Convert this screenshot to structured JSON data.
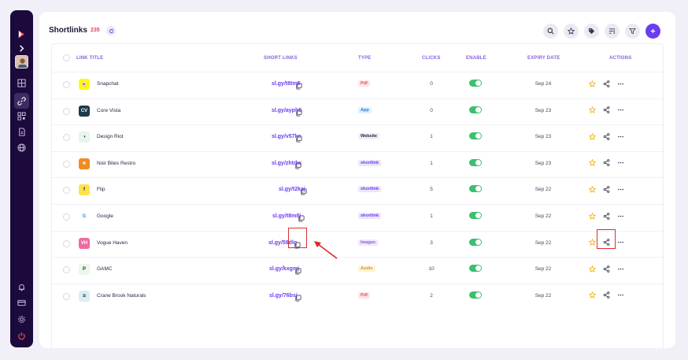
{
  "header": {
    "title": "Shortlinks",
    "count": "235"
  },
  "columns": {
    "link_title": "LINK TITLE",
    "short_links": "SHORT LINKS",
    "type": "TYPE",
    "clicks": "CLICKS",
    "enable": "ENABLE",
    "expiry_date": "EXPIRY DATE",
    "actions": "ACTIONS"
  },
  "rows": [
    {
      "name": "Snapchat",
      "short": "sl.gy/t8tm5",
      "type": "Pdf",
      "clicks": "0",
      "expiry": "Sep 24",
      "logo_color": "#fffc00",
      "logo_glyph": "👻"
    },
    {
      "name": "Core Vista",
      "short": "sl.gy/ayph5",
      "type": "App",
      "clicks": "0",
      "expiry": "Sep 23",
      "logo_color": "#1e3a4c",
      "logo_glyph": "CV"
    },
    {
      "name": "Design Riot",
      "short": "sl.gy/v57ke",
      "type": "Website",
      "clicks": "1",
      "expiry": "Sep 23",
      "logo_color": "#e8f5ec",
      "logo_glyph": "◑"
    },
    {
      "name": "Noir Bites Restro",
      "short": "sl.gy/zhtdw",
      "type": "shortlink",
      "clicks": "1",
      "expiry": "Sep 23",
      "logo_color": "#f08a24",
      "logo_glyph": "❖"
    },
    {
      "name": "Flip",
      "short": "sl.gy/t2kaj",
      "type": "shortlink",
      "clicks": "5",
      "expiry": "Sep 22",
      "logo_color": "#ffe14d",
      "logo_glyph": "f"
    },
    {
      "name": "Google",
      "short": "sl.gy/t8m8j",
      "type": "shortlink",
      "clicks": "1",
      "expiry": "Sep 22",
      "logo_color": "#ffffff",
      "logo_glyph": "G"
    },
    {
      "name": "Vogue Haven",
      "short": "sl.gy/59dlq",
      "type": "Images",
      "clicks": "3",
      "expiry": "Sep 22",
      "logo_color": "#f06aa0",
      "logo_glyph": "VH"
    },
    {
      "name": "GAMC",
      "short": "sl.gy/kxgmj",
      "type": "Audio",
      "clicks": "10",
      "expiry": "Sep 22",
      "logo_color": "#eaf7ea",
      "logo_glyph": "P"
    },
    {
      "name": "Crane Brook Naturals",
      "short": "sl.gy/76bsj",
      "type": "Pdf",
      "clicks": "2",
      "expiry": "Sep 22",
      "logo_color": "#dbeef5",
      "logo_glyph": "≋"
    }
  ],
  "type_styles": {
    "Pdf": {
      "bg": "#fde4e8",
      "fg": "#e8506a"
    },
    "App": {
      "bg": "#dff0fd",
      "fg": "#2a7fd4"
    },
    "Website": {
      "bg": "#efeef3",
      "fg": "#2b2640"
    },
    "shortlink": {
      "bg": "#ece6fb",
      "fg": "#6a3df0"
    },
    "Images": {
      "bg": "#efe7fb",
      "fg": "#8a5fe0"
    },
    "Audio": {
      "bg": "#fff3d6",
      "fg": "#d69a12"
    }
  },
  "colors": {
    "accent": "#6a3df0",
    "sidebar": "#1c0a3d",
    "toggle_on": "#3cbf6e",
    "highlight": "#d93030"
  },
  "toolbar_icons": [
    "search-icon",
    "star-icon",
    "tag-icon",
    "sort-icon",
    "filter-icon",
    "add-icon"
  ]
}
